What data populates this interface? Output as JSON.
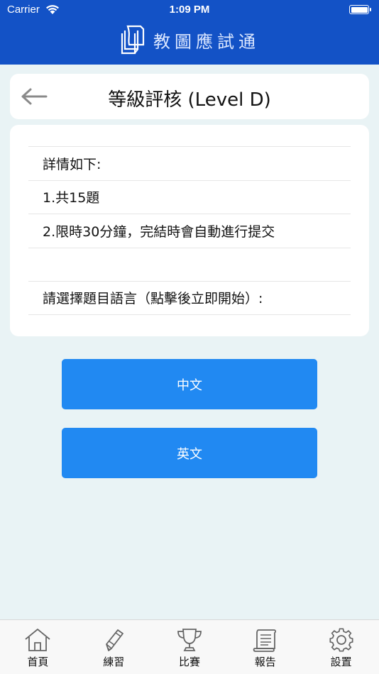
{
  "status_bar": {
    "carrier": "Carrier",
    "time": "1:09 PM"
  },
  "header": {
    "app_title": "教圖應試通"
  },
  "title_card": {
    "title": "等級評核 (Level D)"
  },
  "details": {
    "rows": [
      "詳情如下:",
      "1.共15題",
      "2.限時30分鐘，完結時會自動進行提交",
      "",
      "請選擇題目語言（點擊後立即開始）:"
    ]
  },
  "language_buttons": {
    "chinese": "中文",
    "english": "英文"
  },
  "tab_bar": {
    "items": [
      {
        "label": "首頁",
        "icon": "home-icon"
      },
      {
        "label": "練習",
        "icon": "pencil-icon"
      },
      {
        "label": "比賽",
        "icon": "trophy-icon"
      },
      {
        "label": "報告",
        "icon": "scroll-icon"
      },
      {
        "label": "設置",
        "icon": "gear-icon"
      }
    ]
  },
  "colors": {
    "header_bg": "#1352c6",
    "page_bg": "#e9f3f5",
    "button_bg": "#2189f2"
  }
}
